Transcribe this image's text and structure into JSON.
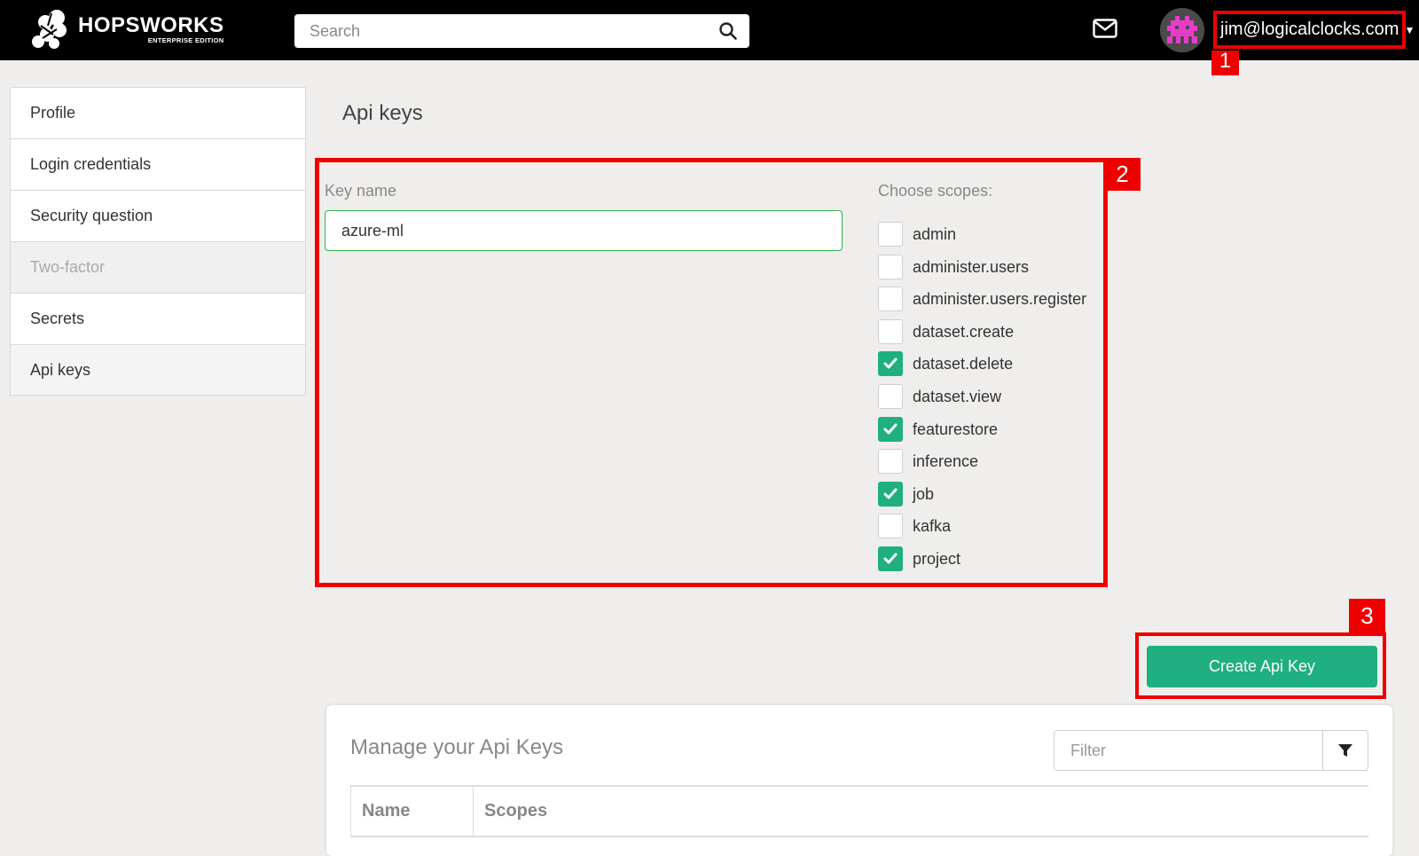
{
  "brand": {
    "title": "HOPSWORKS",
    "subtitle": "ENTERPRISE EDITION"
  },
  "header": {
    "search_placeholder": "Search",
    "user_email": "jim@logicalclocks.com"
  },
  "markers": [
    "1",
    "2",
    "3"
  ],
  "sidebar": {
    "items": [
      {
        "label": "Profile",
        "state": "normal"
      },
      {
        "label": "Login credentials",
        "state": "normal"
      },
      {
        "label": "Security question",
        "state": "normal"
      },
      {
        "label": "Two-factor",
        "state": "disabled"
      },
      {
        "label": "Secrets",
        "state": "normal"
      },
      {
        "label": "Api keys",
        "state": "active"
      }
    ]
  },
  "page": {
    "title": "Api keys"
  },
  "form": {
    "key_name_label": "Key name",
    "key_name_value": "azure-ml",
    "scopes_label": "Choose scopes:",
    "scopes": [
      {
        "name": "admin",
        "checked": false
      },
      {
        "name": "administer.users",
        "checked": false
      },
      {
        "name": "administer.users.register",
        "checked": false
      },
      {
        "name": "dataset.create",
        "checked": false
      },
      {
        "name": "dataset.delete",
        "checked": true
      },
      {
        "name": "dataset.view",
        "checked": false
      },
      {
        "name": "featurestore",
        "checked": true
      },
      {
        "name": "inference",
        "checked": false
      },
      {
        "name": "job",
        "checked": true
      },
      {
        "name": "kafka",
        "checked": false
      },
      {
        "name": "project",
        "checked": true
      }
    ],
    "create_label": "Create Api Key"
  },
  "manage": {
    "title": "Manage your Api Keys",
    "filter_placeholder": "Filter",
    "columns": [
      "Name",
      "Scopes"
    ]
  },
  "colors": {
    "accent": "#1faf80",
    "highlight": "#ee0000",
    "topbar": "#000000"
  }
}
